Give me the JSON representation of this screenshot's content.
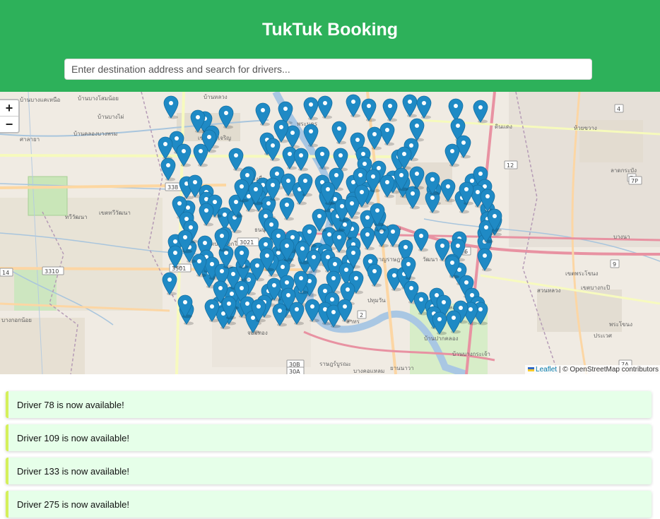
{
  "header": {
    "title": "TukTuk Booking",
    "search_placeholder": "Enter destination address and search for drivers..."
  },
  "map": {
    "zoom_in": "+",
    "zoom_out": "−",
    "attribution_link": "Leaflet",
    "attribution_rest": " | © OpenStreetMap contributors",
    "marker_color": "#1f8ac5",
    "labels": [
      "บ้านบางแคเหนือ",
      "บ้านบางไผ่",
      "บ้านบางโสมน้อย",
      "ศาลายา",
      "ทวีวัฒนา",
      "เขตทวีวัฒนา",
      "บ้านคลองบางพรม",
      "บ้านหลวง",
      "เขตภาษีเจริญ",
      "เขตบางกอกใหญ่",
      "ธนบุรี",
      "บางกอกน้อย",
      "พระนคร",
      "ราชดำเนิน",
      "สำราญราษฎร์",
      "ปทุมวัน",
      "วัฒนา",
      "คลองเตย",
      "เขตพระโขนง",
      "บางนา",
      "ราษฎร์บูรณะ",
      "จอมทอง",
      "ยานนาวา",
      "สาทร",
      "บางคอแหลม",
      "บางซื่อ",
      "ดินแดง",
      "ห้วยขวาง",
      "เขตบางกะปิ",
      "สวนหลวง",
      "ประเวศ",
      "พระโขนง",
      "บ้านปากคลอง",
      "บ้านบางกระเจ้า",
      "ลาดกระบัง"
    ],
    "road_shields": [
      "338",
      "3310",
      "3021",
      "3501",
      "12",
      "7",
      "9",
      "14",
      "30B",
      "30A",
      "2",
      "7P",
      "7A",
      "6",
      "4"
    ]
  },
  "notices": [
    "Driver 78 is now available!",
    "Driver 109 is now available!",
    "Driver 133 is now available!",
    "Driver 275 is now available!"
  ]
}
